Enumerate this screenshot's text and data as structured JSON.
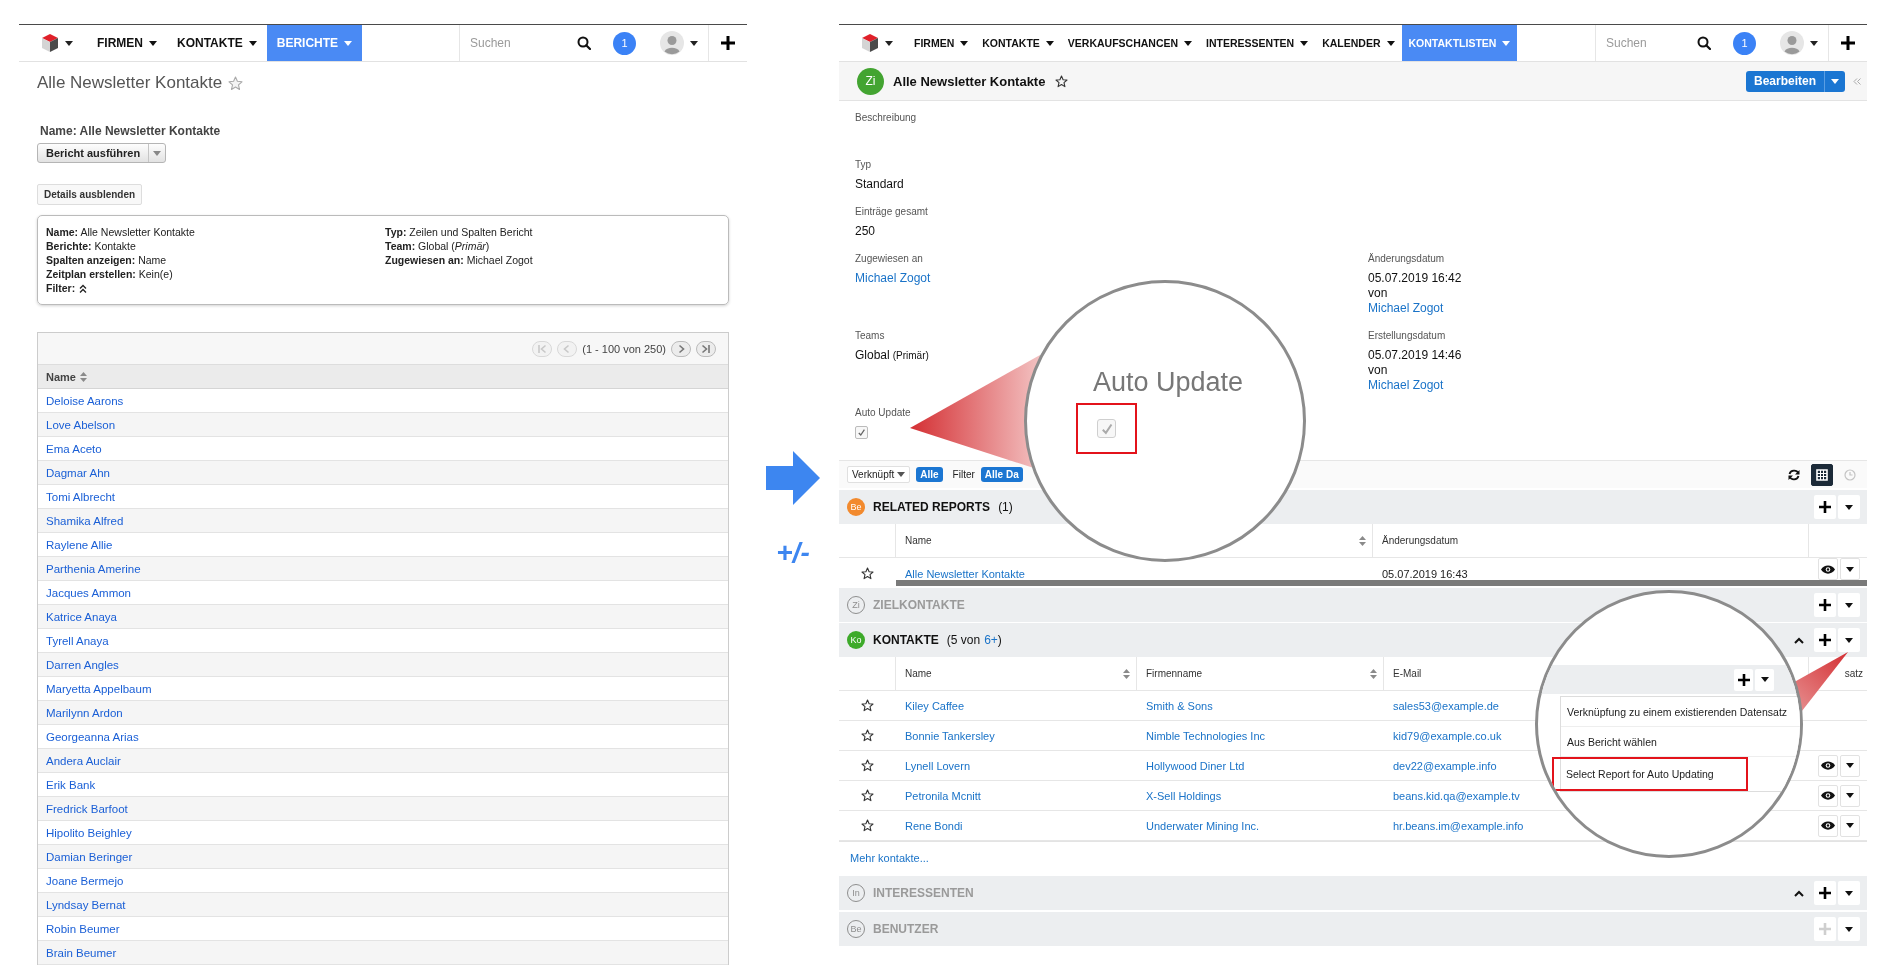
{
  "left_screen": {
    "nav": {
      "items": [
        {
          "label": "FIRMEN",
          "selected": false
        },
        {
          "label": "KONTAKTE",
          "selected": false
        },
        {
          "label": "BERICHTE",
          "selected": true
        }
      ],
      "search": {
        "placeholder": "Suchen"
      },
      "notifications": "1"
    },
    "title": "Alle Newsletter Kontakte",
    "report_name": "Name: Alle Newsletter Kontakte",
    "run_button": "Bericht ausführen",
    "details_button": "Details ausblenden",
    "details": {
      "column_1": [
        {
          "kind": "text",
          "text": "**Name:** Alle Newsletter Kontakte"
        },
        {
          "kind": "text",
          "text": "**Berichte:** Kontakte"
        },
        {
          "kind": "text",
          "text": "**Spalten anzeigen:** Name"
        },
        {
          "kind": "text",
          "text": "**Zeitplan erstellen:** Kein(e)"
        },
        {
          "kind": "icon",
          "text": "**Filter:**"
        }
      ],
      "column_2": [
        {
          "kind": "text",
          "text": "**Typ:** Zeilen und Spalten Bericht"
        },
        {
          "kind": "text",
          "text": "**Team:** Global (*Primär*)"
        },
        {
          "kind": "text",
          "text": "**Zugewiesen an:** Michael Zogot"
        }
      ]
    },
    "pager": {
      "text": "(1 - 100 von 250)",
      "buttons": [
        {
          "kind": "first",
          "disabled": true
        },
        {
          "kind": "prev",
          "disabled": true
        },
        {
          "kind": "next",
          "disabled": false
        },
        {
          "kind": "last",
          "disabled": false
        }
      ]
    },
    "table": {
      "columns": [
        {
          "label": "Name",
          "sortable": true
        }
      ],
      "rows": [
        [
          "Deloise Aarons"
        ],
        [
          "Love Abelson"
        ],
        [
          "Ema Aceto"
        ],
        [
          "Dagmar Ahn"
        ],
        [
          "Tomi Albrecht"
        ],
        [
          "Shamika Alfred"
        ],
        [
          "Raylene Allie"
        ],
        [
          "Parthenia Amerine"
        ],
        [
          "Jacques Ammon"
        ],
        [
          "Katrice Anaya"
        ],
        [
          "Tyrell Anaya"
        ],
        [
          "Darren Angles"
        ],
        [
          "Maryetta Appelbaum"
        ],
        [
          "Marilynn Ardon"
        ],
        [
          "Georgeanna Arias"
        ],
        [
          "Andera Auclair"
        ],
        [
          "Erik Bank"
        ],
        [
          "Fredrick Barfoot"
        ],
        [
          "Hipolito Beighley"
        ],
        [
          "Damian Beringer"
        ],
        [
          "Joane Bermejo"
        ],
        [
          "Lyndsay Bernat"
        ],
        [
          "Robin Beumer"
        ],
        [
          "Brain Beumer"
        ]
      ]
    }
  },
  "transition": {
    "label": "+/-"
  },
  "right_screen": {
    "nav": {
      "items": [
        {
          "label": "FIRMEN",
          "selected": false
        },
        {
          "label": "KONTAKTE",
          "selected": false
        },
        {
          "label": "VERKAUFSCHANCEN",
          "selected": false
        },
        {
          "label": "INTERESSENTEN",
          "selected": false
        },
        {
          "label": "KALENDER",
          "selected": false
        },
        {
          "label": "KONTAKTLISTEN",
          "selected": true
        }
      ],
      "search": {
        "placeholder": "Suchen"
      },
      "notifications": "1"
    },
    "record": {
      "avatar": "Zi",
      "title": "Alle Newsletter Kontakte",
      "edit_button": "Bearbeiten"
    },
    "field_rows": [
      [
        {
          "kind": "text",
          "label": "Beschreibung"
        }
      ],
      [
        {
          "kind": "text",
          "label": "Typ",
          "value": "Standard"
        }
      ],
      [
        {
          "kind": "text",
          "label": "Einträge gesamt",
          "value": "250"
        }
      ],
      [
        {
          "kind": "link",
          "label": "Zugewiesen an",
          "value": "Michael Zogot"
        },
        {
          "kind": "audit",
          "label": "Änderungsdatum",
          "date": "05.07.2019 16:42",
          "by": "von",
          "user": "Michael Zogot"
        }
      ],
      [
        {
          "kind": "team",
          "label": "Teams",
          "value": "Global",
          "note": "(Primär)"
        },
        {
          "kind": "audit",
          "label": "Erstellungsdatum",
          "date": "05.07.2019 14:46",
          "by": "von",
          "user": "Michael Zogot"
        }
      ],
      [
        {
          "kind": "checkbox",
          "label": "Auto Update",
          "checked": true
        }
      ]
    ],
    "toolbar": {
      "linked_label": "Verknüpft",
      "linked_value": "Alle",
      "filter_label": "Filter",
      "filter_value": "Alle Da"
    },
    "sections": [
      {
        "badge": "Be",
        "color": "#f28a2e",
        "title": "RELATED REPORTS",
        "count": {
          "before": "(1)"
        },
        "muted": false,
        "collapsible": false,
        "add_disabled": false,
        "table": {
          "columns": [
            {
              "label": "Name",
              "sortable": true,
              "kind": "link"
            },
            {
              "label": "Änderungsdatum",
              "sortable": false,
              "kind": "text"
            }
          ],
          "rows": [
            {
              "cells": [
                "Alle Newsletter Kontakte",
                "05.07.2019 16:43"
              ],
              "show_actions": true
            }
          ],
          "horizontal_scrollbar": true
        }
      },
      {
        "badge": "Zi",
        "color": "#8e8e8e",
        "title": "ZIELKONTAKTE",
        "muted": true,
        "collapsible": false,
        "add_disabled": false
      },
      {
        "badge": "Ko",
        "color": "#3daa2a",
        "title": "KONTAKTE",
        "count": {
          "before": "(5 von",
          "link": "6+",
          "after": ")"
        },
        "muted": false,
        "collapsible": true,
        "add_disabled": false,
        "table": {
          "columns": [
            {
              "label": "Name",
              "sortable": true,
              "kind": "link"
            },
            {
              "label": "Firmenname",
              "sortable": true,
              "kind": "link"
            },
            {
              "label": "E-Mail",
              "sortable": false,
              "kind": "link"
            },
            {
              "label": "satz",
              "sortable": false
            }
          ],
          "rows": [
            {
              "cells": [
                "Kiley Caffee",
                "Smith & Sons",
                "sales53@example.de"
              ],
              "show_actions": false
            },
            {
              "cells": [
                "Bonnie Tankersley",
                "Nimble Technologies Inc",
                "kid79@example.co.uk"
              ],
              "show_actions": false
            },
            {
              "cells": [
                "Lynell Lovern",
                "Hollywood Diner Ltd",
                "dev22@example.info"
              ],
              "show_actions": true
            },
            {
              "cells": [
                "Petronila Mcnitt",
                "X-Sell Holdings",
                "beans.kid.qa@example.tv"
              ],
              "show_actions": true
            },
            {
              "cells": [
                "Rene Bondi",
                "Underwater Mining Inc.",
                "hr.beans.im@example.info"
              ],
              "show_actions": true
            }
          ],
          "more_link": "Mehr kontakte..."
        }
      },
      {
        "badge": "In",
        "color": "#8e8e8e",
        "title": "INTERESSENTEN",
        "muted": true,
        "collapsible": true,
        "add_disabled": false
      },
      {
        "badge": "Be",
        "color": "#8e8e8e",
        "title": "BENUTZER",
        "muted": true,
        "collapsible": false,
        "add_disabled": true
      }
    ]
  },
  "magnifiers": [
    {
      "kind": "checkbox",
      "label": "Auto Update",
      "checked": true,
      "highlighted": true
    },
    {
      "kind": "menu",
      "items": [
        {
          "label": "Verknüpfung zu einem existierenden Datensatz",
          "highlighted": false
        },
        {
          "label": "Aus Bericht wählen",
          "highlighted": false
        },
        {
          "label": "Select Report for Auto Updating",
          "highlighted": true
        }
      ]
    }
  ]
}
